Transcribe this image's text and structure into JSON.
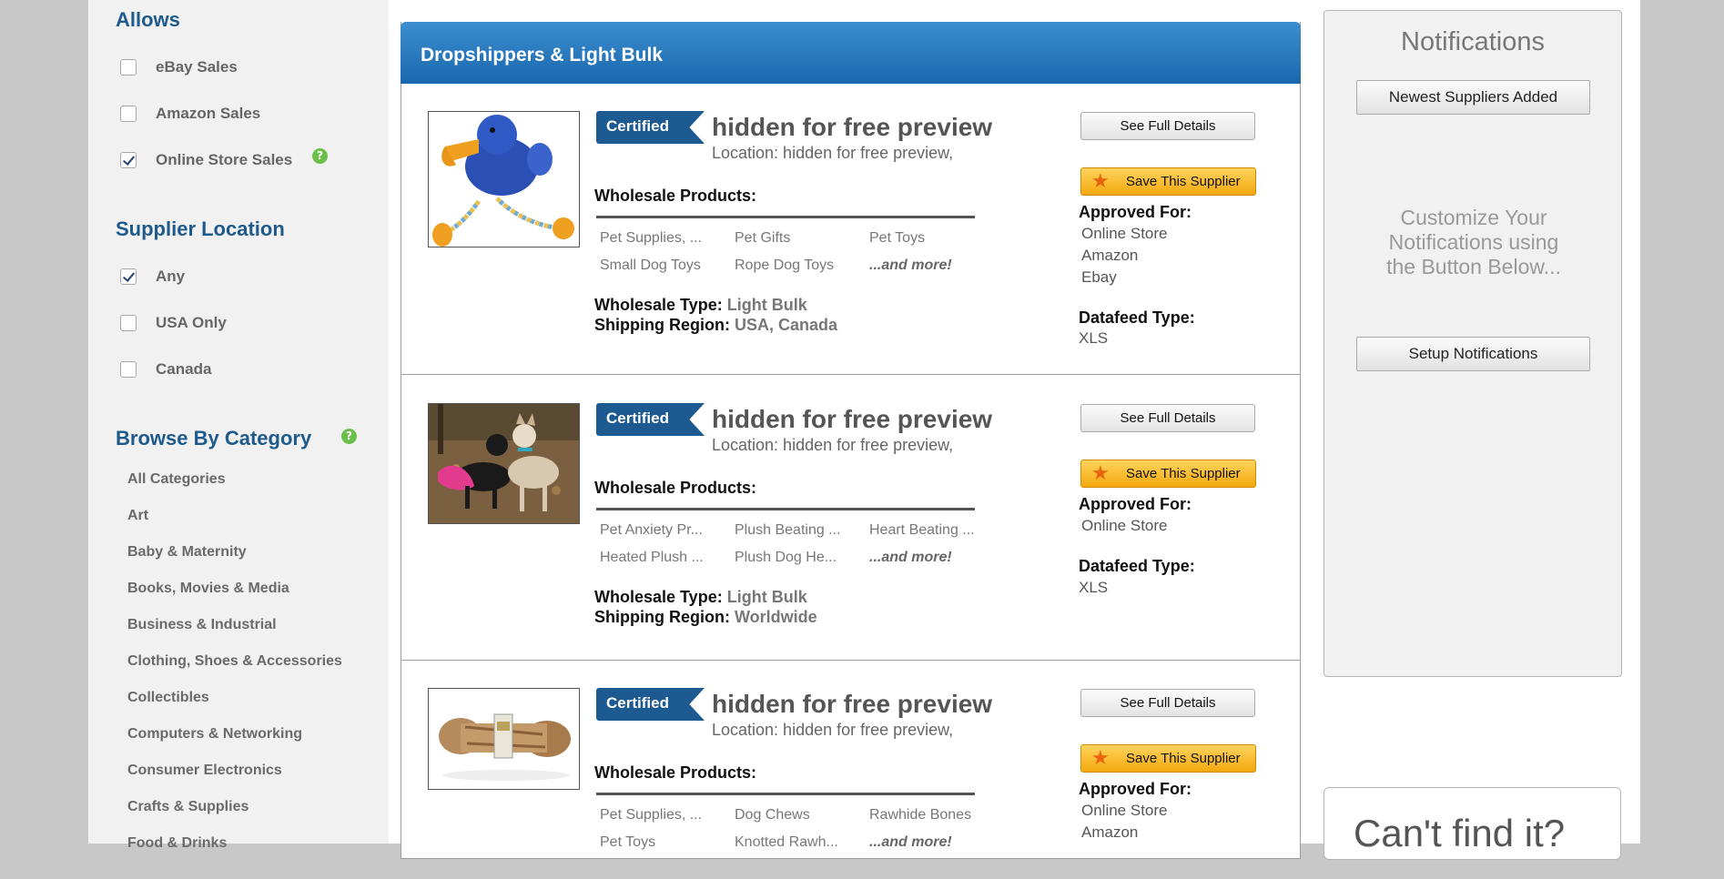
{
  "sidebar": {
    "allows": {
      "heading": "Allows",
      "options": [
        {
          "label": "eBay Sales",
          "checked": false
        },
        {
          "label": "Amazon Sales",
          "checked": false
        },
        {
          "label": "Online Store Sales",
          "checked": true
        }
      ]
    },
    "location": {
      "heading": "Supplier Location",
      "options": [
        {
          "label": "Any",
          "checked": true
        },
        {
          "label": "USA Only",
          "checked": false
        },
        {
          "label": "Canada",
          "checked": false
        }
      ]
    },
    "categories": {
      "heading": "Browse By Category",
      "items": [
        "All Categories",
        "Art",
        "Baby & Maternity",
        "Books, Movies & Media",
        "Business & Industrial",
        "Clothing, Shoes & Accessories",
        "Collectibles",
        "Computers & Networking",
        "Consumer Electronics",
        "Crafts & Supplies",
        "Food & Drinks"
      ]
    },
    "help_glyph": "?"
  },
  "main": {
    "header": "Dropshippers & Light Bulk",
    "badge": "Certified",
    "details_button": "See Full Details",
    "save_button": "Save This Supplier",
    "wholesale_products_label": "Wholesale Products:",
    "wholesale_type_label": "Wholesale Type:",
    "shipping_region_label": "Shipping Region:",
    "approved_for_label": "Approved For:",
    "datafeed_label": "Datafeed Type:",
    "suppliers": [
      {
        "title": "hidden for free preview",
        "location": "Location: hidden for free preview,",
        "products": [
          "Pet Supplies, ...",
          "Pet Gifts",
          "Pet Toys",
          "Small Dog Toys",
          "Rope Dog Toys",
          "...and more!"
        ],
        "wholesale_type": "Light Bulk",
        "shipping_region": "USA, Canada",
        "approved_for": [
          "Online Store",
          "Amazon",
          "Ebay"
        ],
        "datafeed": "XLS"
      },
      {
        "title": "hidden for free preview",
        "location": "Location: hidden for free preview,",
        "products": [
          "Pet Anxiety Pr...",
          "Plush Beating ...",
          "Heart Beating ...",
          "Heated Plush ...",
          "Plush Dog He...",
          "...and more!"
        ],
        "wholesale_type": "Light Bulk",
        "shipping_region": "Worldwide",
        "approved_for": [
          "Online Store"
        ],
        "datafeed": "XLS"
      },
      {
        "title": "hidden for free preview",
        "location": "Location: hidden for free preview,",
        "products": [
          "Pet Supplies, ...",
          "Dog Chews",
          "Rawhide Bones",
          "Pet Toys",
          "Knotted Rawh...",
          "...and more!"
        ],
        "approved_for": [
          "Online Store",
          "Amazon"
        ]
      }
    ]
  },
  "notifications": {
    "title": "Notifications",
    "newest_button": "Newest Suppliers Added",
    "text_line1": "Customize Your",
    "text_line2": "Notifications using",
    "text_line3": "the Button Below...",
    "setup_button": "Setup Notifications"
  },
  "cant_find": {
    "text": "Can't find it?"
  },
  "colors": {
    "accent": "#1e5a8c",
    "header_blue": "#1a67ad",
    "save_orange": "#f4a90e",
    "help_green": "#6cc04a"
  }
}
